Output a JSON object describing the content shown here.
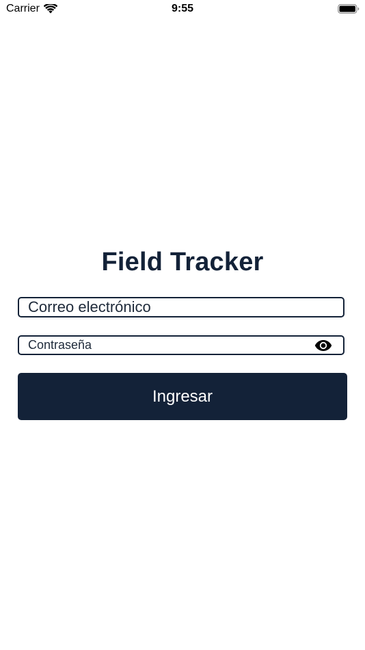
{
  "status_bar": {
    "carrier": "Carrier",
    "time": "9:55",
    "wifi_icon": "wifi-icon",
    "battery_icon": "battery-icon"
  },
  "login": {
    "title": "Field Tracker",
    "email": {
      "placeholder": "Correo electrónico",
      "value": ""
    },
    "password": {
      "placeholder": "Contraseña",
      "value": "",
      "toggle_icon": "eye-icon"
    },
    "submit_label": "Ingresar"
  },
  "colors": {
    "primary": "#132238",
    "background": "#ffffff",
    "button_text": "#ffffff"
  }
}
